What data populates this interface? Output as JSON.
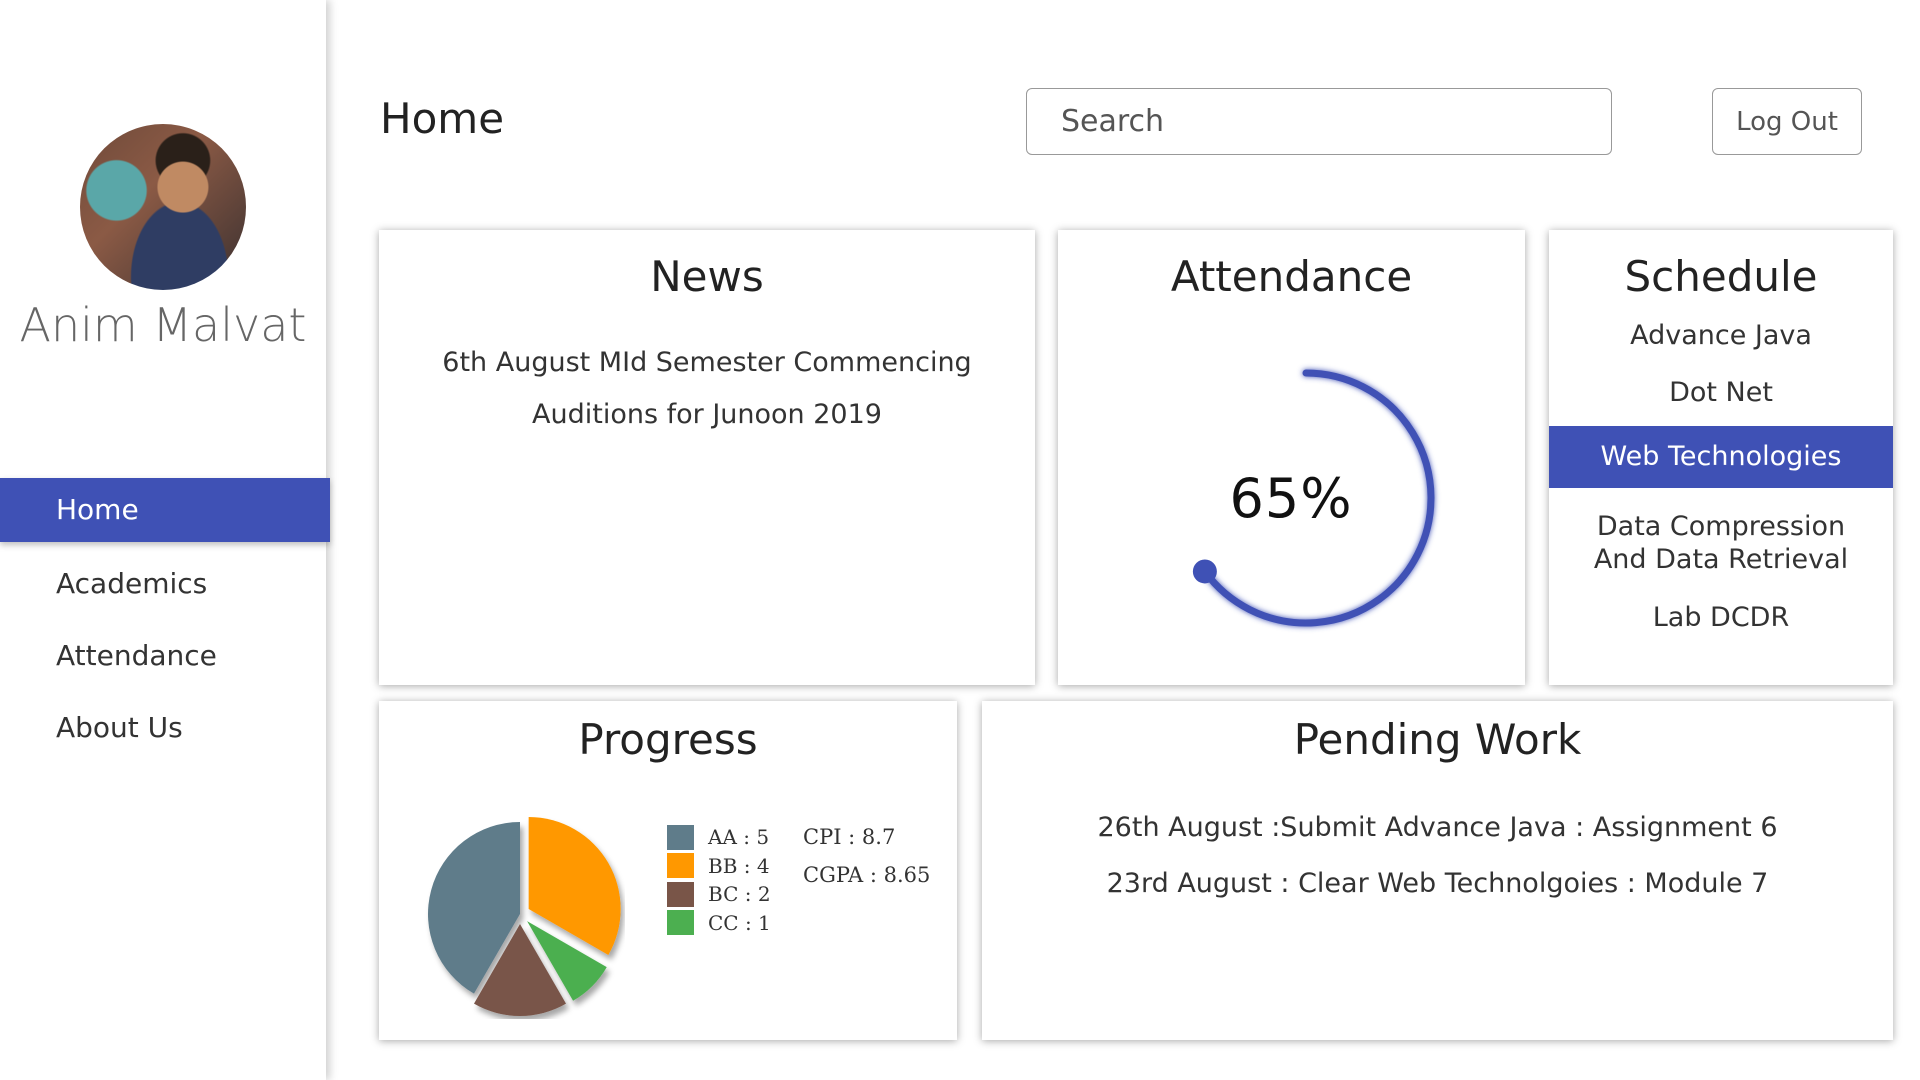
{
  "profile": {
    "name": "Anim Malvat"
  },
  "nav": {
    "items": [
      {
        "label": "Home",
        "active": true
      },
      {
        "label": "Academics"
      },
      {
        "label": "Attendance"
      },
      {
        "label": "About Us"
      }
    ]
  },
  "header": {
    "title": "Home",
    "search_placeholder": "Search",
    "logout_label": "Log Out"
  },
  "news": {
    "title": "News",
    "items": [
      "6th August MId Semester Commencing",
      "Auditions for Junoon 2019"
    ]
  },
  "attendance": {
    "title": "Attendance",
    "percent": 65,
    "percent_label": "65%",
    "accent": "#3f51b5"
  },
  "schedule": {
    "title": "Schedule",
    "items": [
      "Advance Java",
      "Dot Net",
      "Web Technologies",
      "Data Compression And Data Retrieval",
      "Lab DCDR"
    ],
    "active_index": 2
  },
  "progress": {
    "title": "Progress",
    "legend": [
      "AA : 5",
      "BB : 4",
      "BC : 2",
      "CC : 1"
    ],
    "cpi": "CPI : 8.7",
    "cgpa": "CGPA : 8.65",
    "colors": [
      "#5f7c8a",
      "#ff9800",
      "#795548",
      "#4caf50"
    ]
  },
  "chart_data": {
    "type": "pie",
    "categories": [
      "AA",
      "BB",
      "BC",
      "CC"
    ],
    "values": [
      5,
      4,
      2,
      1
    ],
    "colors": [
      "#5f7c8a",
      "#ff9800",
      "#795548",
      "#4caf50"
    ]
  },
  "pending": {
    "title": "Pending Work",
    "items": [
      "26th August :Submit Advance Java : Assignment 6",
      "23rd August : Clear Web Technolgoies : Module 7"
    ]
  },
  "colors": {
    "accent": "#3f51b5"
  }
}
